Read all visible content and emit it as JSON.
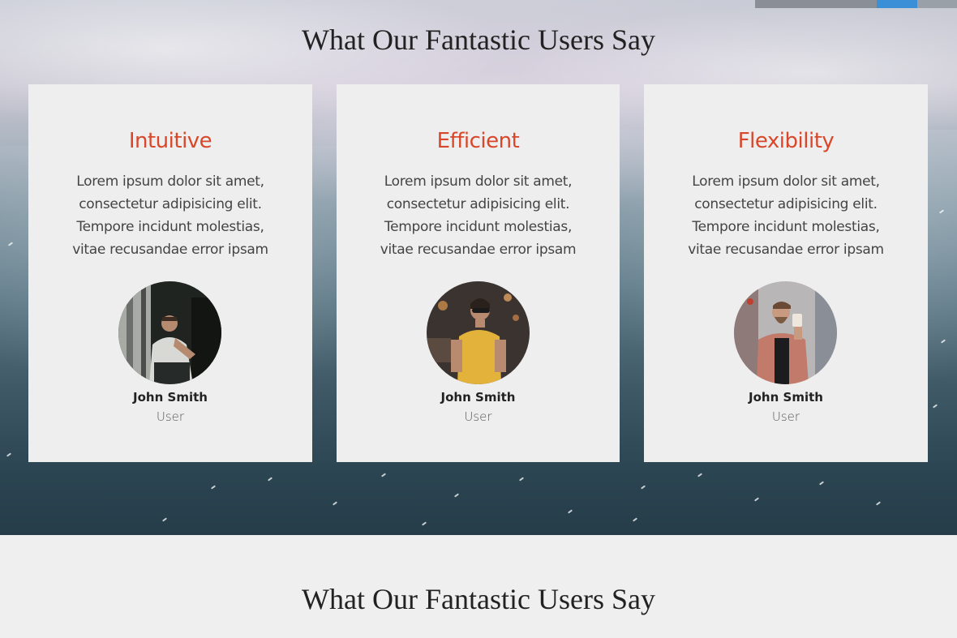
{
  "sections": {
    "top_title": "What Our Fantastic Users Say",
    "bottom_title": "What Our Fantastic Users Say"
  },
  "cards": [
    {
      "heading": "Intuitive",
      "text": "Lorem ipsum dolor sit amet, consectetur adipisicing elit. Tempore incidunt molestias, vitae recusandae error ipsam",
      "name": "John Smith",
      "role": "User"
    },
    {
      "heading": "Efficient",
      "text": "Lorem ipsum dolor sit amet, consectetur adipisicing elit. Tempore incidunt molestias, vitae recusandae error ipsam",
      "name": "John Smith",
      "role": "User"
    },
    {
      "heading": "Flexibility",
      "text": "Lorem ipsum dolor sit amet, consectetur adipisicing elit. Tempore incidunt molestias, vitae recusandae error ipsam",
      "name": "John Smith",
      "role": "User"
    }
  ],
  "colors": {
    "accent": "#d9472b",
    "card_bg": "#eeeeee",
    "page_bg": "#efefef"
  }
}
